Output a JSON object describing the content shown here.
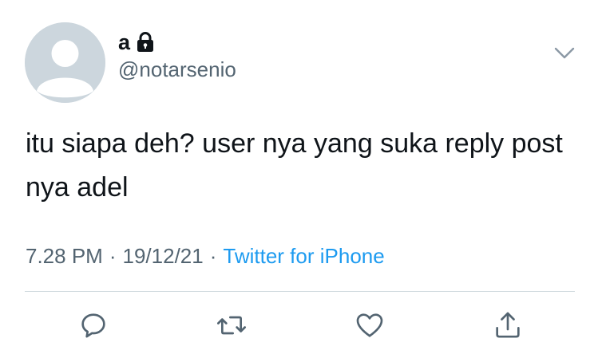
{
  "tweet": {
    "display_name": "a",
    "handle": "@notarsenio",
    "text": "itu siapa deh? user nya yang suka reply post nya adel",
    "time": "7.28 PM",
    "date": "19/12/21",
    "separator": "·",
    "source": "Twitter for iPhone"
  },
  "icons": {
    "avatar": "default-avatar",
    "lock": "lock-icon",
    "more": "chevron-down-icon",
    "reply": "reply-icon",
    "retweet": "retweet-icon",
    "like": "heart-icon",
    "share": "share-icon"
  },
  "colors": {
    "text": "#0f1419",
    "secondary": "#536471",
    "link": "#1d9bf0",
    "avatar_bg": "#ccd6dd",
    "divider": "#cfd9de"
  }
}
